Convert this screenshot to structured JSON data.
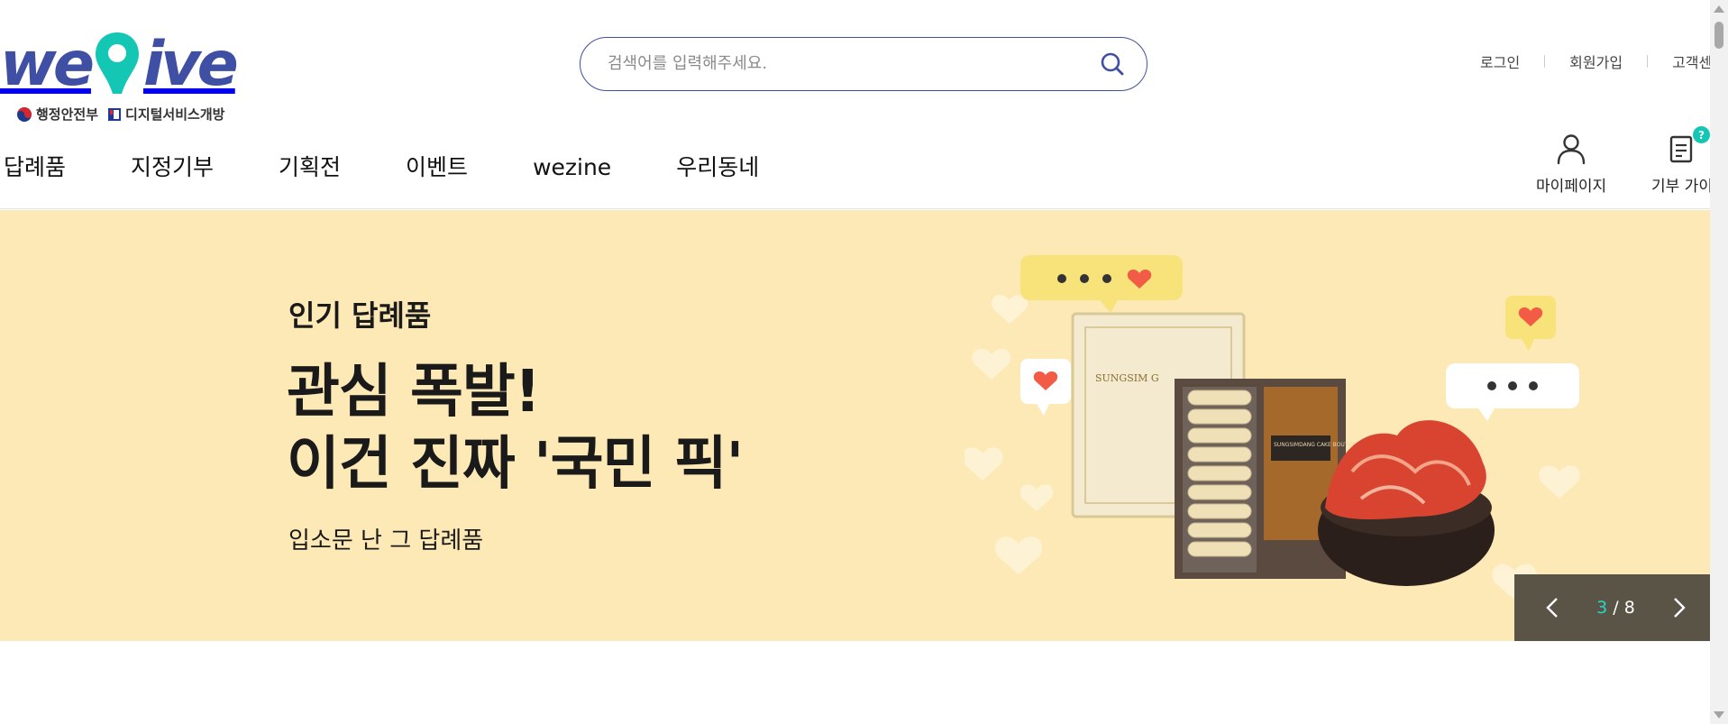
{
  "brand": {
    "logo_text_left": "we",
    "logo_text_right": "ive",
    "gov_org": "행정안전부",
    "digital_service": "디지털서비스개방",
    "colors": {
      "primary": "#3f4fa3",
      "accent": "#14c7b4",
      "banner_bg": "#fde9b5",
      "slider_bg": "#5a5447"
    }
  },
  "search": {
    "placeholder": "검색어를 입력해주세요.",
    "value": "",
    "icon": "search-icon"
  },
  "util_links": [
    "로그인",
    "회원가입",
    "고객센"
  ],
  "gnb": [
    "답례품",
    "지정기부",
    "기획전",
    "이벤트",
    "wezine",
    "우리동네"
  ],
  "quick": {
    "mypage_label": "마이페이지",
    "mypage_icon": "user-icon",
    "donate_label": "기부 가이",
    "donate_icon": "document-icon",
    "donate_badge": "?"
  },
  "banner": {
    "eyebrow": "인기 답례품",
    "headline_line1": "관심 폭발!",
    "headline_line2": "이건 진짜 '국민 픽'",
    "sub": "입소문 난 그 답례품",
    "product_box_text": "SUNGSIM G",
    "product_card_text": "SUNGSIMDANG CAKE BOUTIQUE"
  },
  "slider": {
    "current": "3",
    "separator": " / ",
    "total": "8"
  }
}
